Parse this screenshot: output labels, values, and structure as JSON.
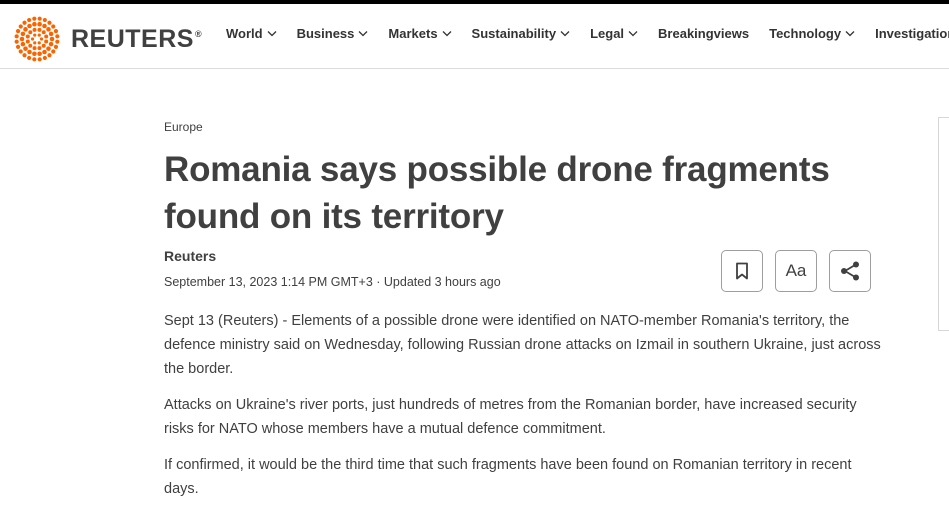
{
  "header": {
    "brand": "REUTERS",
    "brand_mark": "®",
    "logo_icon": "reuters-dots-logo",
    "nav": [
      {
        "label": "World",
        "dropdown": true
      },
      {
        "label": "Business",
        "dropdown": true
      },
      {
        "label": "Markets",
        "dropdown": true
      },
      {
        "label": "Sustainability",
        "dropdown": true
      },
      {
        "label": "Legal",
        "dropdown": true
      },
      {
        "label": "Breakingviews",
        "dropdown": false
      },
      {
        "label": "Technology",
        "dropdown": true
      },
      {
        "label": "Investigations",
        "dropdown": false
      }
    ]
  },
  "article": {
    "section": "Europe",
    "headline": "Romania says possible drone fragments found on its territory",
    "byline": "Reuters",
    "dateline": "September 13, 2023 1:14 PM GMT+3 · Updated 3 hours ago",
    "tools": {
      "bookmark_icon": "bookmark-icon",
      "font_size_label": "Aa",
      "share_icon": "share-icon"
    },
    "paragraphs": [
      "Sept 13 (Reuters) - Elements of a possible drone were identified on NATO-member Romania's territory, the defence ministry said on Wednesday, following Russian drone attacks on Izmail in southern Ukraine, just across the border.",
      "Attacks on Ukraine's river ports, just hundreds of metres from the Romanian border, have increased security risks for NATO whose members have a mutual defence commitment.",
      "If confirmed, it would be the third time that such fragments have been found on Romanian territory in recent days."
    ]
  },
  "colors": {
    "brand_orange": "#fa6400",
    "text": "#404040",
    "border": "#dcdcdc"
  }
}
